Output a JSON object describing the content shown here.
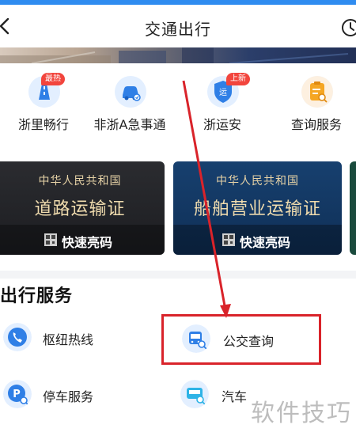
{
  "header": {
    "title": "交通出行"
  },
  "shortcuts": [
    {
      "label": "浙里畅行",
      "icon": "road-icon",
      "badge": "最热"
    },
    {
      "label": "非浙A急事通",
      "icon": "car-icon",
      "badge": ""
    },
    {
      "label": "浙运安",
      "icon": "shield-transport-icon",
      "badge": "上新"
    },
    {
      "label": "查询服务",
      "icon": "clipboard-search-icon",
      "badge": ""
    }
  ],
  "certificates": [
    {
      "issuer": "中华人民共和国",
      "name": "道路运输证",
      "action": "快速亮码"
    },
    {
      "issuer": "中华人民共和国",
      "name": "船舶营业运输证",
      "action": "快速亮码"
    }
  ],
  "services": {
    "title": "出行服务",
    "items": [
      {
        "label": "枢纽热线",
        "icon": "phone-icon"
      },
      {
        "label": "公交查询",
        "icon": "bus-search-icon"
      },
      {
        "label": "停车服务",
        "icon": "parking-search-icon"
      },
      {
        "label": "汽车",
        "icon": "vehicle-search-icon"
      }
    ]
  },
  "watermark": "软件技巧",
  "colors": {
    "accent": "#2f8cf0",
    "badge": "#f2453d",
    "annotation": "#d9232a"
  }
}
